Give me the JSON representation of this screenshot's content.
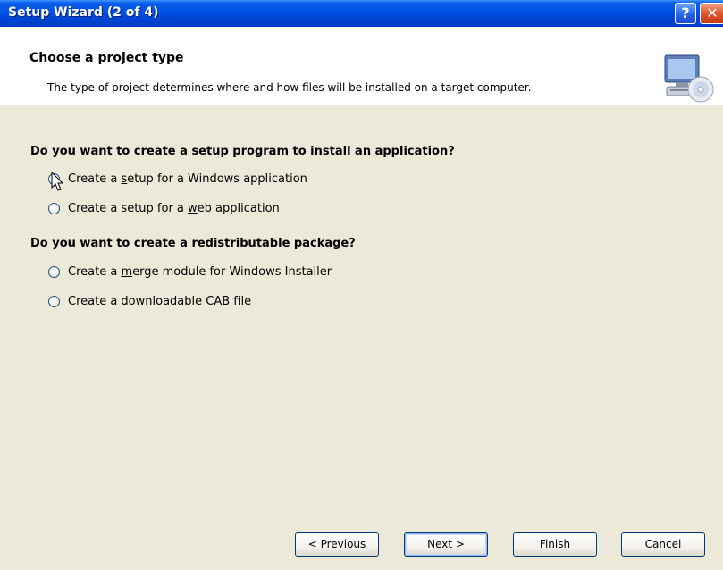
{
  "window": {
    "title": "Setup Wizard (2 of 4)",
    "help_label": "?",
    "close_label": "✕"
  },
  "header": {
    "title": "Choose a project type",
    "description": "The type of project determines where and how files will be installed on a target computer.",
    "icon": "monitor-cd-icon"
  },
  "section1": {
    "question": "Do you want to create a setup program to install an application?",
    "options": [
      {
        "pre": "Create a ",
        "acc": "s",
        "post": "etup for a Windows application",
        "checked": true
      },
      {
        "pre": "Create a setup for a ",
        "acc": "w",
        "post": "eb application",
        "checked": false
      }
    ]
  },
  "section2": {
    "question": "Do you want to create a redistributable package?",
    "options": [
      {
        "pre": "Create a ",
        "acc": "m",
        "post": "erge module for Windows Installer",
        "checked": false
      },
      {
        "pre": "Create a downloadable ",
        "acc": "C",
        "post": "AB file",
        "checked": false
      }
    ]
  },
  "buttons": {
    "previous": {
      "pre": "< ",
      "acc": "P",
      "post": "revious"
    },
    "next": {
      "pre": "",
      "acc": "N",
      "post": "ext >"
    },
    "finish": {
      "pre": "",
      "acc": "F",
      "post": "inish"
    },
    "cancel": "Cancel"
  },
  "colors": {
    "titlebar": "#0055e5",
    "dialog_bg": "#ece9d8",
    "radio_checked": "#21a121"
  }
}
